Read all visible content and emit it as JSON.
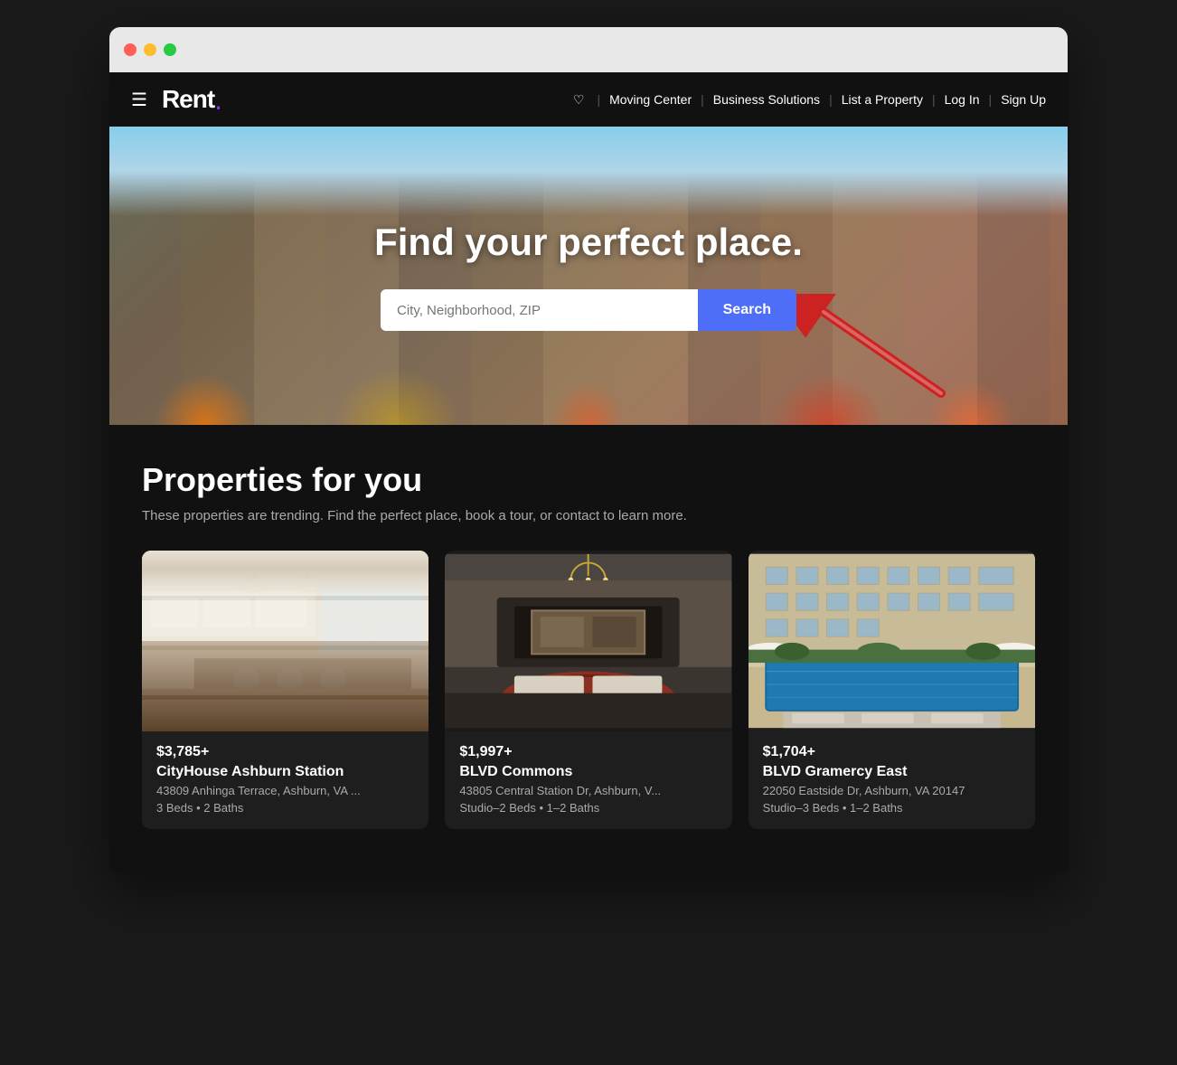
{
  "browser": {
    "traffic_lights": [
      "red",
      "yellow",
      "green"
    ]
  },
  "navbar": {
    "logo_text": "Rent",
    "logo_dot": ".",
    "heart_label": "♡",
    "nav_links": [
      {
        "id": "moving-center",
        "label": "Moving Center"
      },
      {
        "id": "business-solutions",
        "label": "Business Solutions"
      },
      {
        "id": "list-property",
        "label": "List a Property"
      },
      {
        "id": "login",
        "label": "Log In"
      },
      {
        "id": "signup",
        "label": "Sign Up"
      }
    ]
  },
  "hero": {
    "title": "Find your perfect place.",
    "search_placeholder": "City, Neighborhood, ZIP",
    "search_button_label": "Search"
  },
  "properties_section": {
    "title": "Properties for you",
    "subtitle": "These properties are trending. Find the perfect place, book a tour, or contact to learn more.",
    "cards": [
      {
        "id": "card-1",
        "price": "$3,785+",
        "name": "CityHouse Ashburn Station",
        "address": "43809 Anhinga Terrace, Ashburn, VA ...",
        "details": "3 Beds • 2 Baths",
        "image_type": "kitchen"
      },
      {
        "id": "card-2",
        "price": "$1,997+",
        "name": "BLVD Commons",
        "address": "43805 Central Station Dr, Ashburn, V...",
        "details": "Studio–2 Beds • 1–2 Baths",
        "image_type": "lobby"
      },
      {
        "id": "card-3",
        "price": "$1,704+",
        "name": "BLVD Gramercy East",
        "address": "22050 Eastside Dr, Ashburn, VA 20147",
        "details": "Studio–3 Beds • 1–2 Baths",
        "image_type": "pool"
      }
    ]
  }
}
